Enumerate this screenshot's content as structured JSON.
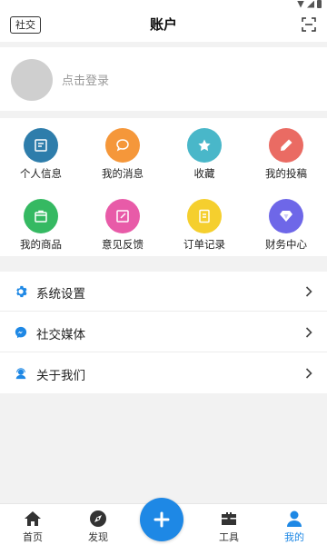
{
  "header": {
    "social_label": "社交",
    "title": "账户"
  },
  "login": {
    "prompt": "点击登录"
  },
  "grid": {
    "items": [
      {
        "label": "个人信息",
        "color": "#2e7dab",
        "icon": "profile-card-icon"
      },
      {
        "label": "我的消息",
        "color": "#f5973a",
        "icon": "message-bubble-icon"
      },
      {
        "label": "收藏",
        "color": "#49b7c9",
        "icon": "star-icon"
      },
      {
        "label": "我的投稿",
        "color": "#ea6b63",
        "icon": "pencil-icon"
      },
      {
        "label": "我的商品",
        "color": "#35b962",
        "icon": "shopping-bag-icon"
      },
      {
        "label": "意见反馈",
        "color": "#e85ba8",
        "icon": "edit-note-icon"
      },
      {
        "label": "订单记录",
        "color": "#f5cf2e",
        "icon": "document-icon"
      },
      {
        "label": "财务中心",
        "color": "#6e67e8",
        "icon": "diamond-icon"
      }
    ]
  },
  "menu": {
    "items": [
      {
        "label": "系统设置",
        "icon": "gear-icon"
      },
      {
        "label": "社交媒体",
        "icon": "messenger-icon"
      },
      {
        "label": "关于我们",
        "icon": "support-agent-icon"
      }
    ]
  },
  "tabbar": {
    "items": [
      {
        "label": "首页",
        "icon": "home-icon"
      },
      {
        "label": "发现",
        "icon": "compass-icon"
      },
      {
        "label": "工具",
        "icon": "toolbox-icon"
      },
      {
        "label": "我的",
        "icon": "person-icon",
        "active": true
      }
    ],
    "accent": "#1e88e5"
  }
}
